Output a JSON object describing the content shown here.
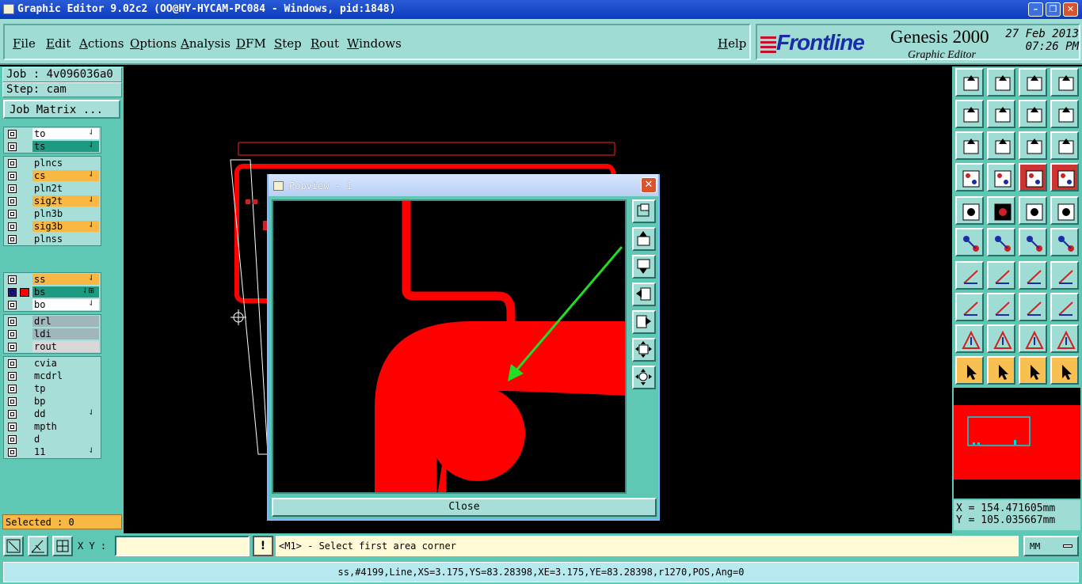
{
  "window": {
    "title": "Graphic Editor 9.02c2 (OO@HY-HYCAM-PC084 - Windows, pid:1848)"
  },
  "menu": [
    {
      "label": "File"
    },
    {
      "label": "Edit"
    },
    {
      "label": "Actions"
    },
    {
      "label": "Options"
    },
    {
      "label": "Analysis"
    },
    {
      "label": "DFM"
    },
    {
      "label": "Step"
    },
    {
      "label": "Rout"
    },
    {
      "label": "Windows"
    }
  ],
  "help_label": "Help",
  "brand": {
    "logo": "Frontline",
    "product": "Genesis 2000",
    "subtitle": "Graphic Editor",
    "date": "27 Feb 2013",
    "time": "07:26 PM"
  },
  "job": {
    "job_line": "Job : 4v096036a0",
    "step_line": "Step: cam",
    "matrix_button": "Job Matrix ..."
  },
  "layers": {
    "group1": [
      {
        "name": "to",
        "color": "#ffffff",
        "flag": "⇃"
      },
      {
        "name": "ts",
        "color": "#1f9a82",
        "flag": "⇃"
      }
    ],
    "group2": [
      {
        "name": "plncs",
        "color": "#a7dfd8",
        "flag": ""
      },
      {
        "name": "cs",
        "color": "#f7b944",
        "flag": "⇃"
      },
      {
        "name": "pln2t",
        "color": "#a7dfd8",
        "flag": ""
      },
      {
        "name": "sig2t",
        "color": "#f7b944",
        "flag": "⇃"
      },
      {
        "name": "pln3b",
        "color": "#a7dfd8",
        "flag": ""
      },
      {
        "name": "sig3b",
        "color": "#f7b944",
        "flag": "⇃"
      },
      {
        "name": "plnss",
        "color": "#a7dfd8",
        "flag": ""
      }
    ],
    "group3": [
      {
        "name": "ss",
        "color": "#f7b944",
        "flag": "⇃"
      },
      {
        "name": "bs",
        "color": "#1f9a82",
        "flag": "⇃⊞"
      },
      {
        "name": "bo",
        "color": "#ffffff",
        "flag": "⇃"
      }
    ],
    "group4": [
      {
        "name": "drl",
        "color": "#9fb6bb",
        "flag": ""
      },
      {
        "name": "ldi",
        "color": "#9fb6bb",
        "flag": ""
      },
      {
        "name": "rout",
        "color": "#d8d8d8",
        "flag": ""
      }
    ],
    "group5": [
      {
        "name": "cvia",
        "color": "#a7dfd8",
        "flag": ""
      },
      {
        "name": "mcdrl",
        "color": "#a7dfd8",
        "flag": ""
      },
      {
        "name": "tp",
        "color": "#a7dfd8",
        "flag": ""
      },
      {
        "name": "bp",
        "color": "#a7dfd8",
        "flag": ""
      },
      {
        "name": "dd",
        "color": "#a7dfd8",
        "flag": "⇃"
      },
      {
        "name": "mpth",
        "color": "#a7dfd8",
        "flag": ""
      },
      {
        "name": "d",
        "color": "#a7dfd8",
        "flag": ""
      },
      {
        "name": "11",
        "color": "#a7dfd8",
        "flag": "⇃"
      }
    ]
  },
  "selected": "Selected : 0",
  "popview": {
    "title": "Popview - 1",
    "close_button": "Close"
  },
  "coords": {
    "x": "X = 154.471605mm",
    "y": "Y = 105.035667mm"
  },
  "command": {
    "xy_label": "X Y :",
    "xy_value": "",
    "prompt": "<M1> - Select first area corner",
    "units": "MM"
  },
  "status": "ss,#4199,Line,XS=3.175,YS=83.28398,XE=3.175,YE=83.28398,r1270,POS,Ang=0",
  "colors": {
    "feature": "#ff0000",
    "arrow": "#22dd22",
    "panel": "#5fc8b4",
    "outline": "#00d8e0"
  }
}
